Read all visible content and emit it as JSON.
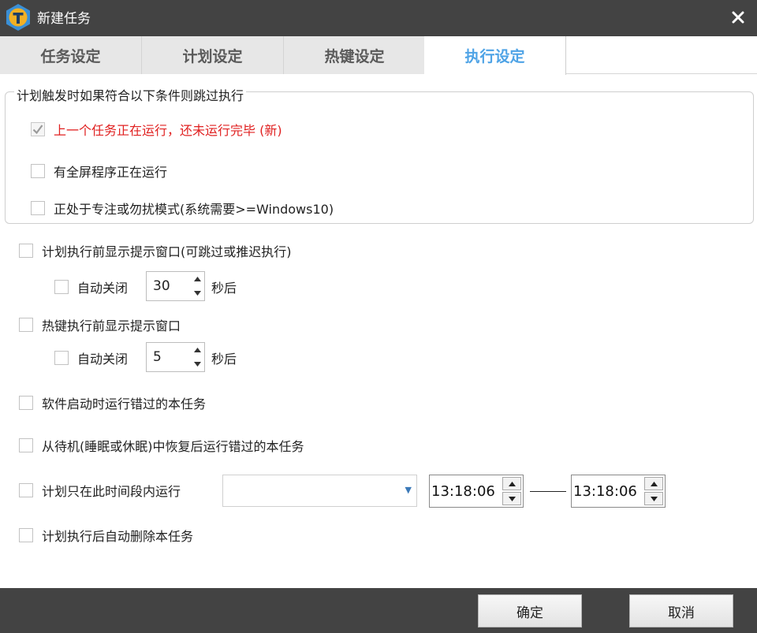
{
  "window": {
    "title": "新建任务"
  },
  "tabs": [
    {
      "label": "任务设定",
      "active": false
    },
    {
      "label": "计划设定",
      "active": false
    },
    {
      "label": "热键设定",
      "active": false
    },
    {
      "label": "执行设定",
      "active": true
    }
  ],
  "skip_group": {
    "title": "计划触发时如果符合以下条件则跳过执行",
    "options": [
      {
        "label": "上一个任务正在运行，还未运行完毕 (新)",
        "checked": true
      },
      {
        "label": "有全屏程序正在运行",
        "checked": false
      },
      {
        "label": "正处于专注或勿扰模式(系统需要>=Windows10)",
        "checked": false
      }
    ]
  },
  "plan_prompt": {
    "label": "计划执行前显示提示窗口(可跳过或推迟执行)",
    "checked": false,
    "auto_close_label": "自动关闭",
    "auto_close_checked": false,
    "seconds": "30",
    "unit": "秒后"
  },
  "hotkey_prompt": {
    "label": "热键执行前显示提示窗口",
    "checked": false,
    "auto_close_label": "自动关闭",
    "auto_close_checked": false,
    "seconds": "5",
    "unit": "秒后"
  },
  "run_missed_on_start": {
    "label": "软件启动时运行错过的本任务",
    "checked": false
  },
  "run_missed_on_resume": {
    "label": "从待机(睡眠或休眠)中恢复后运行错过的本任务",
    "checked": false
  },
  "time_window": {
    "label": "计划只在此时间段内运行",
    "checked": false,
    "combo_value": "",
    "start": "13:18:06",
    "end": "13:18:06"
  },
  "auto_delete": {
    "label": "计划执行后自动删除本任务",
    "checked": false
  },
  "footer": {
    "ok": "确定",
    "cancel": "取消"
  },
  "colors": {
    "titlebar": "#434343",
    "active_tab": "#4ea3e6",
    "warning_text": "#e02020"
  }
}
